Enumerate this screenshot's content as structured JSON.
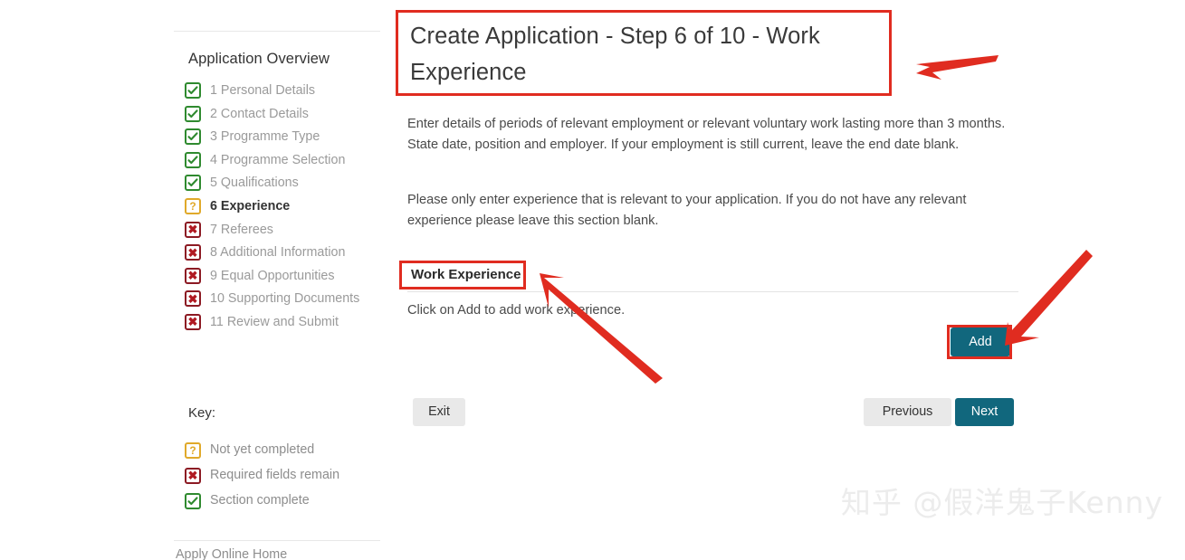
{
  "sidebar": {
    "title": "Application Overview",
    "items": [
      {
        "label": "1 Personal Details",
        "status": "done",
        "icon": "check-icon",
        "current": false
      },
      {
        "label": "2 Contact Details",
        "status": "done",
        "icon": "check-icon",
        "current": false
      },
      {
        "label": "3 Programme Type",
        "status": "done",
        "icon": "check-icon",
        "current": false
      },
      {
        "label": "4 Programme Selection",
        "status": "done",
        "icon": "check-icon",
        "current": false
      },
      {
        "label": "5 Qualifications",
        "status": "done",
        "icon": "check-icon",
        "current": false
      },
      {
        "label": "6 Experience",
        "status": "todo",
        "icon": "question-icon",
        "current": true
      },
      {
        "label": "7 Referees",
        "status": "req",
        "icon": "cross-icon",
        "current": false
      },
      {
        "label": "8 Additional Information",
        "status": "req",
        "icon": "cross-icon",
        "current": false
      },
      {
        "label": "9 Equal Opportunities",
        "status": "req",
        "icon": "cross-icon",
        "current": false
      },
      {
        "label": "10 Supporting Documents",
        "status": "req",
        "icon": "cross-icon",
        "current": false
      },
      {
        "label": "11 Review and Submit",
        "status": "req",
        "icon": "cross-icon",
        "current": false
      }
    ],
    "key_title": "Key:",
    "key": [
      {
        "label": "Not yet completed",
        "status": "todo",
        "icon": "question-icon"
      },
      {
        "label": "Required fields remain",
        "status": "req",
        "icon": "cross-icon"
      },
      {
        "label": "Section complete",
        "status": "done",
        "icon": "check-icon"
      }
    ],
    "footer_link": "Apply Online Home"
  },
  "main": {
    "title": "Create Application - Step 6 of 10 - Work Experience",
    "paragraph1": "Enter details of periods of relevant employment or relevant voluntary work lasting more than 3 months. State date, position and employer. If your employment is still current, leave the end date blank.",
    "paragraph2": "Please only enter experience that is relevant to your application. If you do not have any relevant experience please leave this section blank.",
    "section_heading": "Work Experience",
    "empty_note": "Click on Add to add work experience.",
    "buttons": {
      "add": "Add",
      "exit": "Exit",
      "previous": "Previous",
      "next": "Next"
    }
  },
  "watermark": "知乎 @假洋鬼子Kenny",
  "colors": {
    "teal_button": "#11677d",
    "grey_button": "#e9e9e9",
    "annotation_red": "#e02c20",
    "status_done": "#2f8a2f",
    "status_todo": "#e0a92a",
    "status_required": "#8c1a23"
  }
}
